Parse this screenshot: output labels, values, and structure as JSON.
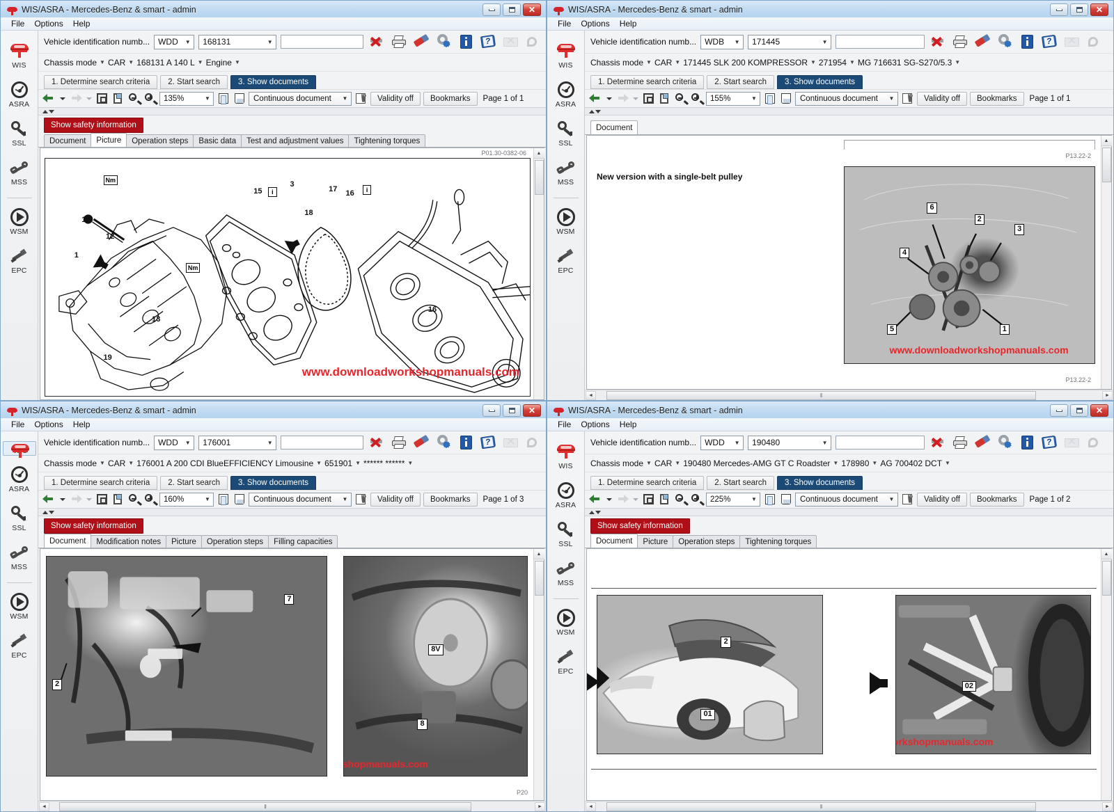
{
  "app": {
    "title": "WIS/ASRA - Mercedes-Benz & smart - admin",
    "menu": [
      "File",
      "Options",
      "Help"
    ],
    "window_buttons": {
      "minimize": "Minimize",
      "maximize": "Maximize",
      "close": "Close"
    }
  },
  "sidebar": {
    "items": [
      {
        "label": "WIS",
        "icon": "car-icon"
      },
      {
        "label": "ASRA",
        "icon": "gauge-icon"
      },
      {
        "label": "SSL",
        "icon": "key-icon"
      },
      {
        "label": "MSS",
        "icon": "wrench-icon"
      },
      {
        "label": "WSM",
        "icon": "play-circle-icon"
      },
      {
        "label": "EPC",
        "icon": "spark-plug-icon"
      }
    ]
  },
  "vin_bar": {
    "label": "Vehicle identification numb...",
    "search_placeholder": "",
    "search_value": "",
    "icons": [
      {
        "name": "delete-icon",
        "title": "Delete"
      },
      {
        "name": "print-icon",
        "title": "Print"
      },
      {
        "name": "eraser-icon",
        "title": "Clear"
      },
      {
        "name": "gear-icon",
        "title": "Settings"
      },
      {
        "name": "info-icon",
        "title": "Information"
      },
      {
        "name": "help-icon",
        "title": "Help"
      },
      {
        "name": "mail-icon",
        "title": "Mail"
      },
      {
        "name": "misc-icon",
        "title": "More"
      }
    ]
  },
  "steps": [
    {
      "label": "1. Determine search criteria",
      "active": false
    },
    {
      "label": "2. Start search",
      "active": false
    },
    {
      "label": "3. Show documents",
      "active": true
    }
  ],
  "doc_toolbar": {
    "mode_label": "Continuous document",
    "validity_label": "Validity off",
    "bookmarks_label": "Bookmarks",
    "icons": [
      {
        "name": "back-arrow-icon"
      },
      {
        "name": "back-dropdown-icon"
      },
      {
        "name": "forward-arrow-icon"
      },
      {
        "name": "forward-dropdown-icon"
      },
      {
        "name": "fit-page-icon"
      },
      {
        "name": "rotate-page-icon"
      },
      {
        "name": "zoom-out-icon"
      },
      {
        "name": "zoom-in-icon"
      },
      {
        "name": "single-page-icon"
      },
      {
        "name": "two-page-icon"
      },
      {
        "name": "hand-tool-icon"
      }
    ]
  },
  "safety_button": "Show safety information",
  "scroll": {
    "up": "▲",
    "down": "▼",
    "left": "◄",
    "right": "►",
    "grip": "‖"
  },
  "sort_arrows": {
    "up": "▲",
    "down": "▼"
  },
  "watermark": "www.downloadworkshopmanuals.com",
  "colors": {
    "accent_blue": "#1c4a77",
    "safety_red": "#b00f17",
    "watermark_red": "#e8262c",
    "titlebar_blue": "#c3dcf2",
    "brand_red": "#d4232b"
  },
  "panels": [
    {
      "id": "panel-1",
      "vin": {
        "prefix": "WDD",
        "number": "168131"
      },
      "chassis": [
        "Chassis mode",
        "CAR",
        "168131 A 140 L",
        "Engine"
      ],
      "zoom": "135%",
      "page": "Page 1 of 1",
      "tabs": [
        {
          "label": "Document",
          "active": false
        },
        {
          "label": "Picture",
          "active": true
        },
        {
          "label": "Operation steps",
          "active": false
        },
        {
          "label": "Basic data",
          "active": false
        },
        {
          "label": "Test and adjustment values",
          "active": false
        },
        {
          "label": "Tightening torques",
          "active": false
        }
      ],
      "has_safety": true,
      "doc_code": "P01.30-0382-06",
      "figure_type": "engine-line-drawing",
      "callouts": [
        "14",
        "12",
        "1",
        "13",
        "19",
        "15",
        "3",
        "17",
        "16",
        "18",
        "16",
        "Nm",
        "Nm"
      ]
    },
    {
      "id": "panel-2",
      "vin": {
        "prefix": "WDB",
        "number": "171445"
      },
      "chassis": [
        "Chassis mode",
        "CAR",
        "171445 SLK 200 KOMPRESSOR",
        "271954",
        "MG 716631 SG-S270/5.3"
      ],
      "zoom": "155%",
      "page": "Page 1 of 1",
      "tabs": [
        {
          "label": "Document",
          "active": true
        }
      ],
      "has_safety": false,
      "heading": "New version with a single-belt pulley",
      "doc_code_top": "P13.22-2",
      "doc_code_bottom": "P13.22-2",
      "figure_type": "engine-photo",
      "callouts": [
        "6",
        "2",
        "3",
        "4",
        "5",
        "1"
      ]
    },
    {
      "id": "panel-3",
      "vin": {
        "prefix": "WDD",
        "number": "176001"
      },
      "chassis": [
        "Chassis mode",
        "CAR",
        "176001 A 200 CDI BlueEFFICIENCY Limousine",
        "651901",
        "****** ******"
      ],
      "zoom": "160%",
      "page": "Page 1 of 3",
      "tabs": [
        {
          "label": "Document",
          "active": true
        },
        {
          "label": "Modification notes",
          "active": false
        },
        {
          "label": "Picture",
          "active": false
        },
        {
          "label": "Operation steps",
          "active": false
        },
        {
          "label": "Filling capacities",
          "active": false
        }
      ],
      "has_safety": true,
      "doc_code": "P20",
      "figure_type": "two-engine-bay-photos",
      "callouts": [
        "2",
        "7",
        "8V",
        "8"
      ]
    },
    {
      "id": "panel-4",
      "vin": {
        "prefix": "WDD",
        "number": "190480"
      },
      "chassis": [
        "Chassis mode",
        "CAR",
        "190480 Mercedes-AMG GT C Roadster",
        "178980",
        "AG 700402 DCT"
      ],
      "zoom": "225%",
      "page": "Page 1 of 2",
      "tabs": [
        {
          "label": "Document",
          "active": true
        },
        {
          "label": "Picture",
          "active": false
        },
        {
          "label": "Operation steps",
          "active": false
        },
        {
          "label": "Tightening torques",
          "active": false
        }
      ],
      "has_safety": true,
      "figure_type": "car-and-chassis-photos",
      "callouts": [
        "2",
        "01",
        "02"
      ]
    }
  ]
}
